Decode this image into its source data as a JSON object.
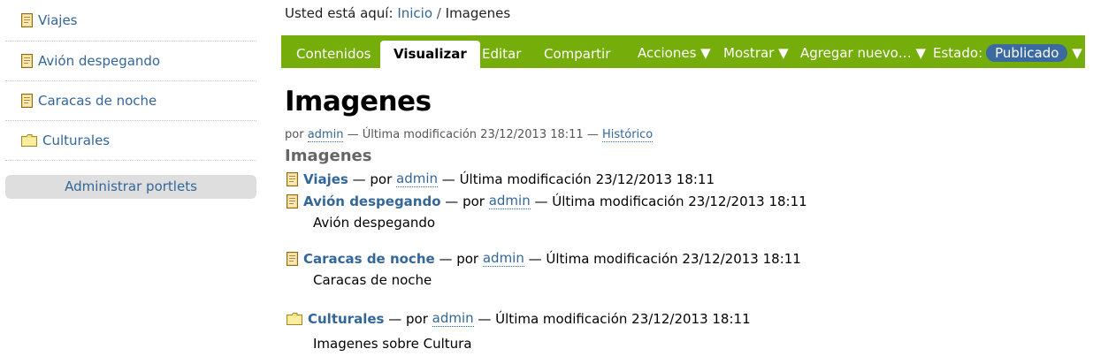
{
  "sidebar": {
    "items": [
      {
        "label": "Viajes",
        "icon": "page-icon"
      },
      {
        "label": "Avión despegando",
        "icon": "page-icon"
      },
      {
        "label": "Caracas de noche",
        "icon": "page-icon"
      },
      {
        "label": "Culturales",
        "icon": "folder-icon"
      }
    ],
    "manage_label": "Administrar portlets"
  },
  "breadcrumb": {
    "prefix": "Usted está aquí:",
    "home": "Inicio",
    "separator": "/",
    "current": "Imagenes"
  },
  "toolbar": {
    "tabs": [
      "Contenidos",
      "Visualizar",
      "Editar",
      "Compartir"
    ],
    "active_tab": "Visualizar",
    "actions": "Acciones ▼",
    "display": "Mostrar ▼",
    "add_new": "Agregar nuevo… ▼",
    "state_label": "Estado:",
    "state_value": "Publicado",
    "state_arrow": "▼",
    "colors": {
      "bar": "#75ad0a",
      "state_pill": "#3b6aa0"
    }
  },
  "page": {
    "title": "Imagenes",
    "by": "por",
    "author": "admin",
    "modified": "— Última modificación 23/12/2013 18:11 —",
    "history": "Histórico",
    "subtitle": "Imagenes"
  },
  "entries": [
    {
      "title": "Viajes",
      "sep": " — por ",
      "author": "admin",
      "modified": " — Última modificación 23/12/2013 18:11",
      "description": "",
      "icon": "page-icon"
    },
    {
      "title": "Avión despegando",
      "sep": " — por ",
      "author": "admin",
      "modified": " — Última modificación 23/12/2013 18:11",
      "description": "Avión despegando",
      "icon": "page-icon"
    },
    {
      "title": "Caracas de noche",
      "sep": " — por ",
      "author": "admin",
      "modified": " — Última modificación 23/12/2013 18:11",
      "description": "Caracas de noche",
      "icon": "page-icon"
    },
    {
      "title": "Culturales",
      "sep": " — por ",
      "author": "admin",
      "modified": " — Última modificación 23/12/2013 18:11",
      "description": "Imagenes sobre Cultura",
      "icon": "folder-icon"
    }
  ]
}
